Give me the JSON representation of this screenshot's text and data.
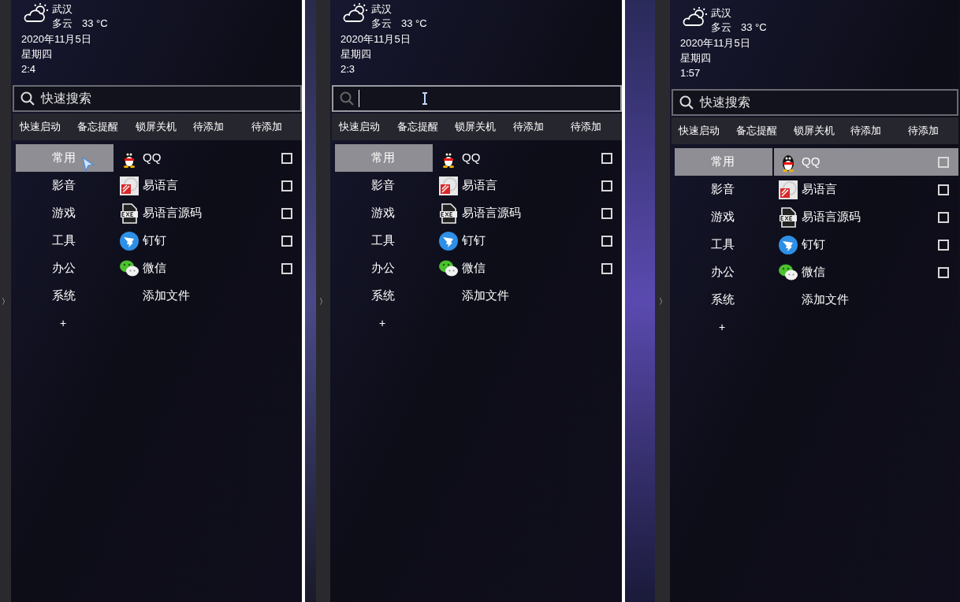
{
  "panels": [
    {
      "handle": "〉",
      "weather": {
        "city": "武汉",
        "condition": "多云",
        "temperature": "33 °C"
      },
      "date": "2020年11月5日",
      "weekday": "星期四",
      "time": "2:4",
      "search": {
        "placeholder": "快速搜索",
        "focused": false
      },
      "arrow_cursor": true,
      "tabs": [
        "快速启动",
        "备忘提醒",
        "锁屏关机",
        "待添加",
        "待添加"
      ],
      "categories": [
        {
          "label": "常用",
          "selected": true
        },
        {
          "label": "影音",
          "selected": false
        },
        {
          "label": "游戏",
          "selected": false
        },
        {
          "label": "工具",
          "selected": false
        },
        {
          "label": "办公",
          "selected": false
        },
        {
          "label": "系统",
          "selected": false
        }
      ],
      "add_category": "+",
      "apps": [
        {
          "kind": "qq",
          "label": "QQ",
          "checked": false,
          "hovered": false
        },
        {
          "kind": "eyuyan",
          "label": "易语言",
          "checked": false,
          "hovered": false
        },
        {
          "kind": "exe",
          "label": "易语言源码",
          "checked": false,
          "hovered": false
        },
        {
          "kind": "dingtalk",
          "label": "钉钉",
          "checked": false,
          "hovered": false
        },
        {
          "kind": "wechat",
          "label": "微信",
          "checked": false,
          "hovered": false
        },
        {
          "kind": "add",
          "label": "添加文件"
        }
      ]
    },
    {
      "handle": "〉",
      "weather": {
        "city": "武汉",
        "condition": "多云",
        "temperature": "33 °C"
      },
      "date": "2020年11月5日",
      "weekday": "星期四",
      "time": "2:3",
      "search": {
        "focused": true
      },
      "ibeam_cursor": true,
      "tabs": [
        "快速启动",
        "备忘提醒",
        "锁屏关机",
        "待添加",
        "待添加"
      ],
      "categories": [
        {
          "label": "常用",
          "selected": true
        },
        {
          "label": "影音",
          "selected": false
        },
        {
          "label": "游戏",
          "selected": false
        },
        {
          "label": "工具",
          "selected": false
        },
        {
          "label": "办公",
          "selected": false
        },
        {
          "label": "系统",
          "selected": false
        }
      ],
      "add_category": "+",
      "apps": [
        {
          "kind": "qq",
          "label": "QQ",
          "checked": false,
          "hovered": false
        },
        {
          "kind": "eyuyan",
          "label": "易语言",
          "checked": false,
          "hovered": false
        },
        {
          "kind": "exe",
          "label": "易语言源码",
          "checked": false,
          "hovered": false
        },
        {
          "kind": "dingtalk",
          "label": "钉钉",
          "checked": false,
          "hovered": false
        },
        {
          "kind": "wechat",
          "label": "微信",
          "checked": false,
          "hovered": false
        },
        {
          "kind": "add",
          "label": "添加文件"
        }
      ]
    },
    {
      "handle": "〉",
      "weather": {
        "city": "武汉",
        "condition": "多云",
        "temperature": "33 °C"
      },
      "date": "2020年11月5日",
      "weekday": "星期四",
      "time": "1:57",
      "search": {
        "placeholder": "快速搜索",
        "focused": false
      },
      "tabs": [
        "快速启动",
        "备忘提醒",
        "锁屏关机",
        "待添加",
        "待添加"
      ],
      "categories": [
        {
          "label": "常用",
          "selected": true
        },
        {
          "label": "影音",
          "selected": false
        },
        {
          "label": "游戏",
          "selected": false
        },
        {
          "label": "工具",
          "selected": false
        },
        {
          "label": "办公",
          "selected": false
        },
        {
          "label": "系统",
          "selected": false
        }
      ],
      "add_category": "+",
      "apps": [
        {
          "kind": "qq",
          "label": "QQ",
          "checked": false,
          "hovered": true
        },
        {
          "kind": "eyuyan",
          "label": "易语言",
          "checked": false,
          "hovered": false
        },
        {
          "kind": "exe",
          "label": "易语言源码",
          "checked": false,
          "hovered": false
        },
        {
          "kind": "dingtalk",
          "label": "钉钉",
          "checked": false,
          "hovered": false
        },
        {
          "kind": "wechat",
          "label": "微信",
          "checked": false,
          "hovered": false
        },
        {
          "kind": "add",
          "label": "添加文件"
        }
      ]
    }
  ]
}
